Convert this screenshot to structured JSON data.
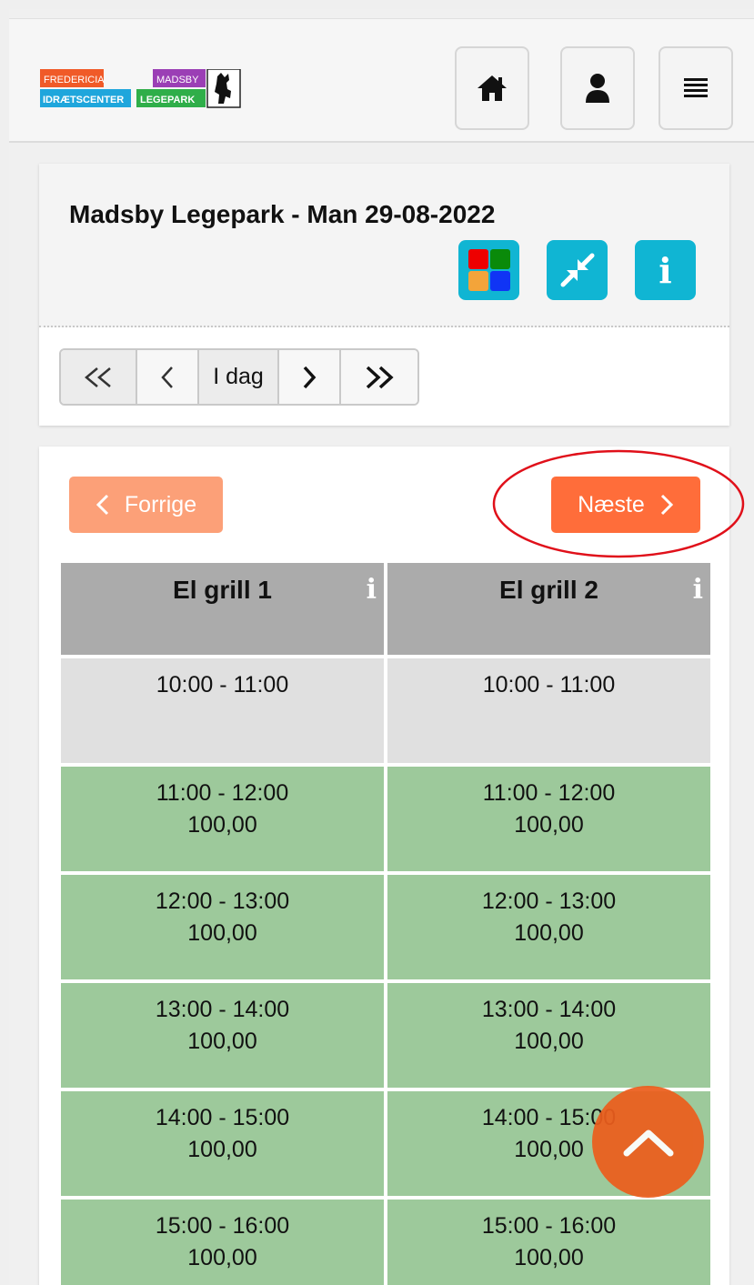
{
  "header": {
    "logo": {
      "line1_left": "FREDERICIA",
      "line2_left": "IDRÆTSCENTER",
      "line1_right": "MADSBY",
      "line2_right": "LEGEPARK"
    },
    "nav": [
      {
        "icon": "home-icon"
      },
      {
        "icon": "user-icon"
      },
      {
        "icon": "menu-icon"
      }
    ]
  },
  "booking": {
    "title": "Madsby Legepark - Man 29-08-2022",
    "tools": [
      {
        "icon": "color-grid-icon",
        "colors": [
          "#ee0000",
          "#0a8a0a",
          "#f3a43a",
          "#1034f5"
        ]
      },
      {
        "icon": "collapse-arrows-icon"
      },
      {
        "icon": "info-icon",
        "glyph": "i"
      }
    ],
    "pager": {
      "first": "«",
      "prev": "‹",
      "today": "I dag",
      "next": "›",
      "last": "»"
    }
  },
  "schedule": {
    "prev_label": "Forrige",
    "next_label": "Næste",
    "columns": [
      {
        "name": "El grill 1",
        "info": "i"
      },
      {
        "name": "El grill 2",
        "info": "i"
      }
    ],
    "rows": [
      {
        "time": "10:00 - 11:00",
        "price": "",
        "status": "unavailable"
      },
      {
        "time": "11:00 - 12:00",
        "price": "100,00",
        "status": "available"
      },
      {
        "time": "12:00 - 13:00",
        "price": "100,00",
        "status": "available"
      },
      {
        "time": "13:00 - 14:00",
        "price": "100,00",
        "status": "available"
      },
      {
        "time": "14:00 - 15:00",
        "price": "100,00",
        "status": "available"
      },
      {
        "time": "15:00 - 16:00",
        "price": "100,00",
        "status": "available"
      }
    ]
  },
  "colors": {
    "accent_orange": "#ff6d3a",
    "prev_button": "#fca078",
    "tool_cyan": "#10b5d3",
    "available_green": "#9dc99b",
    "unavailable_gray": "#e0e0e0",
    "annotation_red": "#e0101a"
  }
}
